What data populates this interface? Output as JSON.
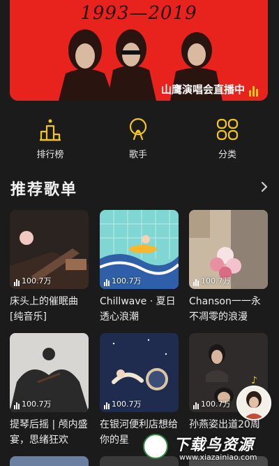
{
  "banner": {
    "years": "1993—2019",
    "caption": "山鹰演唱会直播中",
    "bg_color": "#e8231d"
  },
  "categories": [
    {
      "label": "排行榜",
      "icon": "podium-icon"
    },
    {
      "label": "歌手",
      "icon": "singer-icon"
    },
    {
      "label": "分类",
      "icon": "category-grid-icon"
    }
  ],
  "accent_color": "#f5c518",
  "section": {
    "title": "推荐歌单",
    "more_icon": "chevron-right-icon"
  },
  "playlists": [
    {
      "title": "床头上的催眠曲[纯音乐]",
      "plays": "100.7万"
    },
    {
      "title": "Chillwave · 夏日透心浪潮",
      "plays": "100.7万"
    },
    {
      "title": "Chanson一一永不凋零的浪漫",
      "plays": "100.7万"
    },
    {
      "title": "提琴后摇 | 颅内盛宴，思绪狂欢",
      "plays": "100.7万"
    },
    {
      "title": "在银河便利店想给你的星",
      "plays": "100.7万"
    },
    {
      "title": "孙燕姿出道20周",
      "plays": "100.7万"
    }
  ],
  "watermark": {
    "title": "下载鸟资源",
    "url": "www.xiazainiao.com"
  }
}
